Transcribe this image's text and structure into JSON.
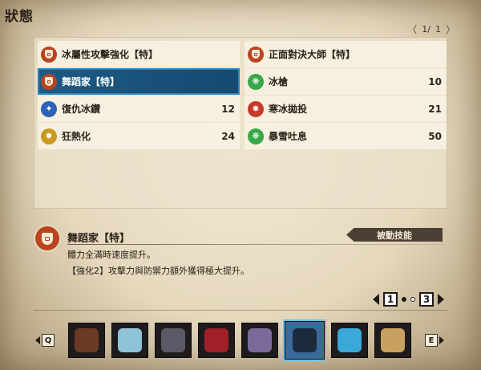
{
  "title": "狀態",
  "pager": {
    "current": "1/",
    "total": "1",
    "prev_icon": "chevron-left-icon",
    "next_icon": "chevron-right-icon"
  },
  "skills_left": [
    {
      "name": "冰屬性攻擊強化【特】",
      "level": "",
      "icon": "shield-icon",
      "selected": false
    },
    {
      "name": "舞蹈家【特】",
      "level": "",
      "icon": "shield-icon",
      "selected": true
    },
    {
      "name": "復仇冰鑽",
      "level": "12",
      "icon": "blue-skill-icon",
      "selected": false
    },
    {
      "name": "狂熱化",
      "level": "24",
      "icon": "gold-skill-icon",
      "selected": false
    }
  ],
  "skills_right": [
    {
      "name": "正面對決大師【特】",
      "level": "",
      "icon": "shield-icon",
      "selected": false
    },
    {
      "name": "冰槍",
      "level": "10",
      "icon": "green-skill-icon",
      "selected": false
    },
    {
      "name": "寒冰拋投",
      "level": "21",
      "icon": "red-skill-icon",
      "selected": false
    },
    {
      "name": "暴雪吐息",
      "level": "50",
      "icon": "green-skill-icon",
      "selected": false
    }
  ],
  "detail": {
    "name": "舞蹈家【特】",
    "tag": "被動技能",
    "line1": "體力全滿時速度提升。",
    "line2": "【強化2】攻擊力與防禦力額外獲得極大提升。"
  },
  "page_indicator": {
    "left": "1",
    "right": "3",
    "active_dot": 1
  },
  "keys": {
    "left": "Q",
    "right": "E"
  },
  "monsters": [
    {
      "name": "monster-1",
      "color": "#6b3a24",
      "active": false
    },
    {
      "name": "monster-2",
      "color": "#8fc3d9",
      "active": false
    },
    {
      "name": "monster-3",
      "color": "#5a5a66",
      "active": false
    },
    {
      "name": "monster-4",
      "color": "#a0202a",
      "active": false
    },
    {
      "name": "monster-5",
      "color": "#7a6a9a",
      "active": false
    },
    {
      "name": "monster-6",
      "color": "#1c2b3c",
      "active": true
    },
    {
      "name": "monster-7",
      "color": "#3aa8d8",
      "active": false
    },
    {
      "name": "monster-8",
      "color": "#c8a060",
      "active": false
    }
  ],
  "colors": {
    "selected_row": "#1d5a86",
    "selected_outline": "#2a83c4",
    "tag_bg": "#4a4035"
  }
}
